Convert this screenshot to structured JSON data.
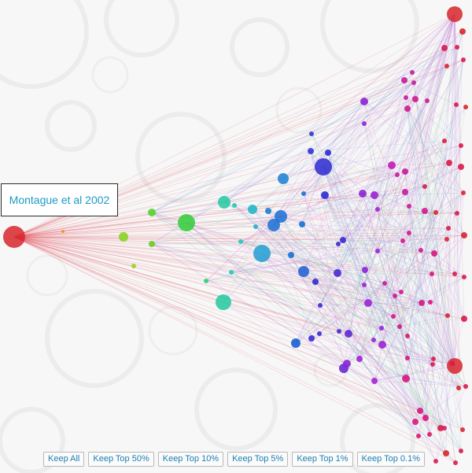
{
  "tooltip": {
    "text": "Montague et al 2002"
  },
  "filters": [
    {
      "label": "Keep All"
    },
    {
      "label": "Keep Top 50%"
    },
    {
      "label": "Keep Top 10%"
    },
    {
      "label": "Keep Top 5%"
    },
    {
      "label": "Keep Top 1%"
    },
    {
      "label": "Keep Top 0.1%"
    }
  ],
  "colors": {
    "background": "#f7f7f7",
    "source_node": "#d7262c",
    "green_node": "#2fcc3a",
    "teal_node": "#22c9b0",
    "blue_node": "#1a6fd3",
    "indigo_node": "#2c2ad1",
    "purple_node": "#8c24d4",
    "magenta_node": "#d0188f",
    "tooltip_text": "#1b9ac6",
    "button_text": "#1b7fb3"
  }
}
